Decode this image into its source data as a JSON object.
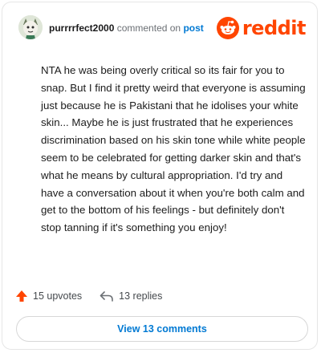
{
  "comment": {
    "author": "purrrrfect2000",
    "action_text": "commented on",
    "post_link_label": "post",
    "brand": "reddit",
    "body": "NTA he was being overly critical so its fair for you to snap. But I find it pretty weird that everyone is assuming just because he is Pakistani that he idolises your white skin... Maybe he is just frustrated that he experiences discrimination based on his skin tone while white people seem to be celebrated for getting darker skin and that's what he means by cultural appropriation. I'd try and have a conversation about it when you're both calm and get to the bottom of his feelings - but definitely don't stop tanning if it's something you enjoy!",
    "upvotes": "15 upvotes",
    "replies": "13 replies",
    "view_comments": "View 13 comments"
  },
  "colors": {
    "brand_orange": "#ff4500",
    "link_blue": "#0079d3",
    "text": "#1a1a1b"
  },
  "icons": {
    "upvote": "upvote-arrow-icon",
    "reply": "reply-arrow-icon",
    "brand": "reddit-alien-icon"
  }
}
